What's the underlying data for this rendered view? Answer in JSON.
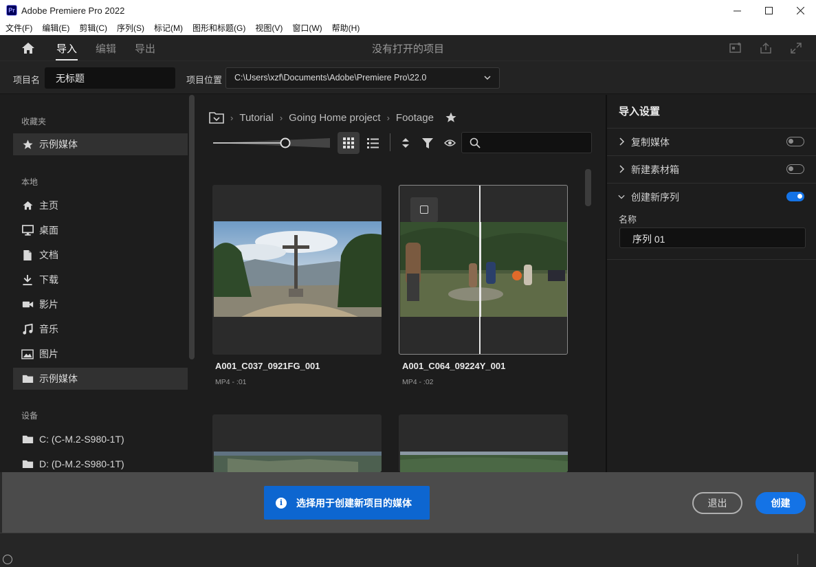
{
  "window": {
    "logo": "Pr",
    "title": "Adobe Premiere Pro 2022",
    "controls": [
      "minimize",
      "maximize",
      "close"
    ]
  },
  "menu": [
    "文件(F)",
    "编辑(E)",
    "剪辑(C)",
    "序列(S)",
    "标记(M)",
    "图形和标题(G)",
    "视图(V)",
    "窗口(W)",
    "帮助(H)"
  ],
  "header": {
    "tabs": [
      {
        "label": "导入",
        "active": true
      },
      {
        "label": "编辑",
        "active": false
      },
      {
        "label": "导出",
        "active": false
      }
    ],
    "center_text": "没有打开的项目"
  },
  "project": {
    "name_label": "项目名",
    "name_value": "无标题",
    "location_label": "项目位置",
    "location_value": "C:\\Users\\xzf\\Documents\\Adobe\\Premiere Pro\\22.0"
  },
  "sidebar": {
    "favorites_title": "收藏夹",
    "favorites": [
      {
        "label": "示例媒体",
        "icon": "star-icon",
        "selected": false
      }
    ],
    "local_title": "本地",
    "local": [
      {
        "label": "主页",
        "icon": "home-icon"
      },
      {
        "label": "桌面",
        "icon": "desktop-icon"
      },
      {
        "label": "文档",
        "icon": "document-icon"
      },
      {
        "label": "下载",
        "icon": "download-icon"
      },
      {
        "label": "影片",
        "icon": "video-icon"
      },
      {
        "label": "音乐",
        "icon": "music-icon"
      },
      {
        "label": "图片",
        "icon": "image-icon"
      },
      {
        "label": "示例媒体",
        "icon": "folder-icon",
        "selected": true
      }
    ],
    "devices_title": "设备",
    "devices": [
      {
        "label": "C: (C-M.2-S980-1T)",
        "icon": "folder-icon"
      },
      {
        "label": "D: (D-M.2-S980-1T)",
        "icon": "folder-icon"
      }
    ]
  },
  "browser": {
    "breadcrumb": [
      "Tutorial",
      "Going Home project",
      "Footage"
    ],
    "clips": [
      {
        "name": "A001_C037_0921FG_001",
        "meta": "MP4 - :01"
      },
      {
        "name": "A001_C064_09224Y_001",
        "meta": "MP4 - :02"
      }
    ]
  },
  "import_settings": {
    "title": "导入设置",
    "copy_media": {
      "label": "复制媒体",
      "on": false
    },
    "new_bin": {
      "label": "新建素材箱",
      "on": false
    },
    "new_sequence": {
      "label": "创建新序列",
      "on": true
    },
    "name_label": "名称",
    "name_value": "序列 01"
  },
  "footer": {
    "info_text": "选择用于创建新项目的媒体",
    "exit_label": "退出",
    "create_label": "创建"
  },
  "colors": {
    "accent": "#1473e6",
    "info_blue": "#0d66d0"
  }
}
